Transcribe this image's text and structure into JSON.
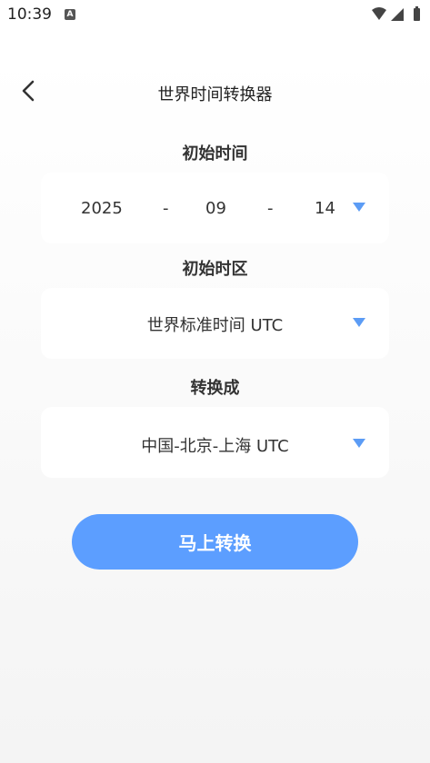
{
  "status_bar": {
    "time": "10:39",
    "notification_glyph": "A"
  },
  "header": {
    "title": "世界时间转换器"
  },
  "start_time": {
    "label": "初始时间",
    "year": "2025",
    "sep1": "-",
    "month": "09",
    "sep2": "-",
    "day": "14"
  },
  "start_zone": {
    "label": "初始时区",
    "value": "世界标准时间 UTC"
  },
  "target_zone": {
    "label": "转换成",
    "value": "中国-北京-上海 UTC"
  },
  "action": {
    "label": "马上转换"
  },
  "colors": {
    "accent": "#5c9eff",
    "dropdown": "#5c9cf5"
  }
}
